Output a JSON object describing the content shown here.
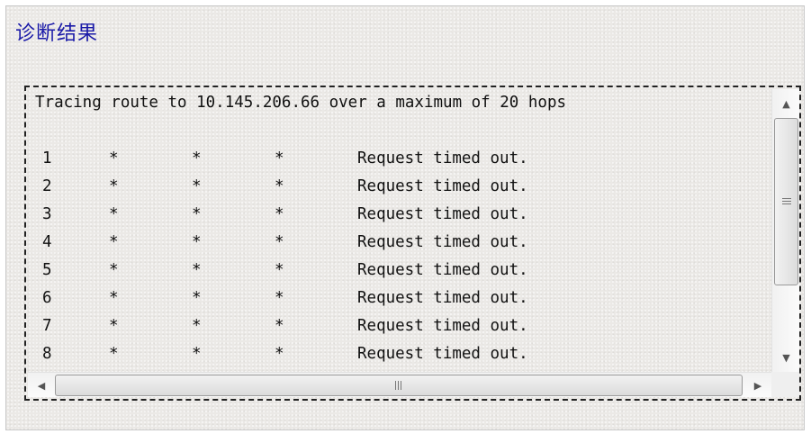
{
  "panel": {
    "title": "诊断结果"
  },
  "output": {
    "header_line": "Tracing route to 10.145.206.66 over a maximum of 20 hops",
    "blank_line": "",
    "hops": [
      {
        "num": "1",
        "r1": "*",
        "r2": "*",
        "r3": "*",
        "message": "Request timed out."
      },
      {
        "num": "2",
        "r1": "*",
        "r2": "*",
        "r3": "*",
        "message": "Request timed out."
      },
      {
        "num": "3",
        "r1": "*",
        "r2": "*",
        "r3": "*",
        "message": "Request timed out."
      },
      {
        "num": "4",
        "r1": "*",
        "r2": "*",
        "r3": "*",
        "message": "Request timed out."
      },
      {
        "num": "5",
        "r1": "*",
        "r2": "*",
        "r3": "*",
        "message": "Request timed out."
      },
      {
        "num": "6",
        "r1": "*",
        "r2": "*",
        "r3": "*",
        "message": "Request timed out."
      },
      {
        "num": "7",
        "r1": "*",
        "r2": "*",
        "r3": "*",
        "message": "Request timed out."
      },
      {
        "num": "8",
        "r1": "*",
        "r2": "*",
        "r3": "*",
        "message": "Request timed out."
      }
    ]
  },
  "scrollbars": {
    "up_glyph": "▲",
    "down_glyph": "▼",
    "left_glyph": "◀",
    "right_glyph": "▶"
  },
  "colors": {
    "title": "#1a1aa8",
    "panel_bg": "#ebe9e6",
    "text": "#111111"
  }
}
